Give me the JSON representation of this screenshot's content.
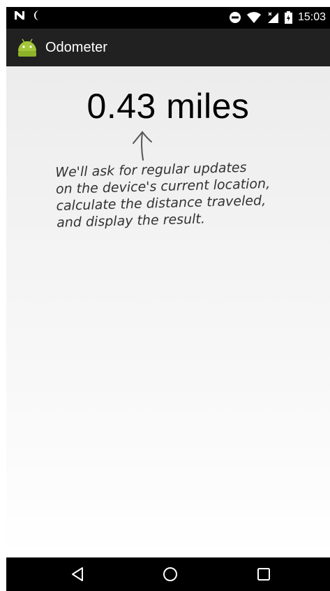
{
  "status_bar": {
    "time": "15:03",
    "icons": [
      "nfc-icon",
      "moon-icon",
      "do-not-disturb-icon",
      "wifi-icon",
      "signal-icon",
      "battery-icon"
    ]
  },
  "action_bar": {
    "app_icon": "android-icon",
    "title": "Odometer"
  },
  "main": {
    "distance": "0.43 miles",
    "annotation_lines": [
      "We'll ask for regular updates",
      "on the device's current location,",
      "calculate the distance traveled,",
      "and display the result."
    ]
  },
  "nav_bar": {
    "buttons": [
      "back-icon",
      "home-icon",
      "recents-icon"
    ]
  }
}
